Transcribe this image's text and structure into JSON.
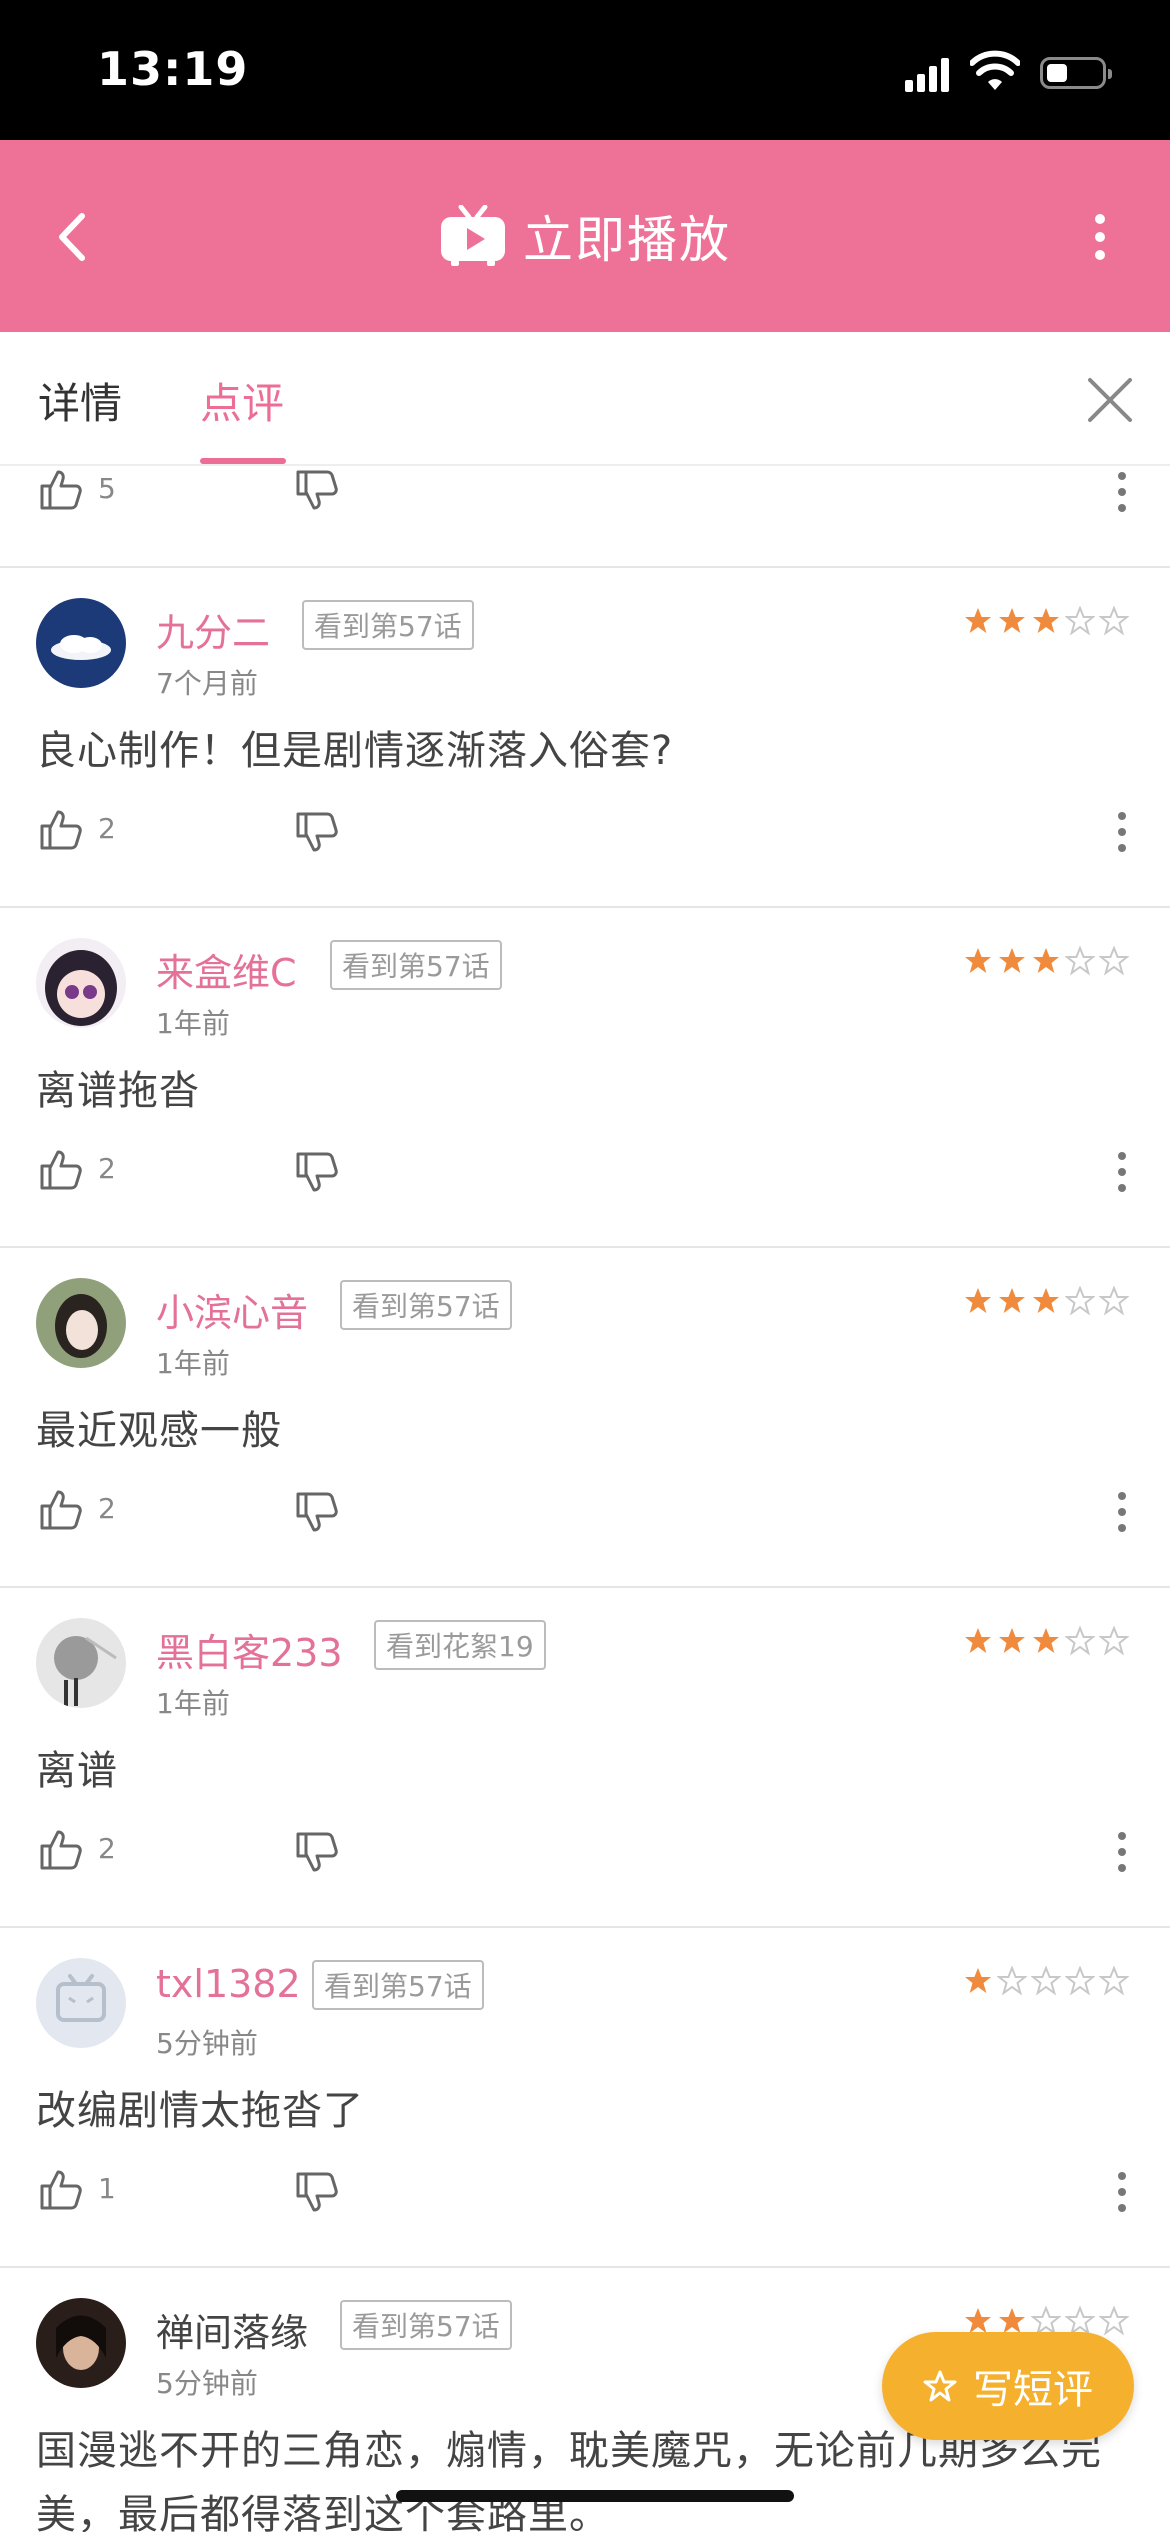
{
  "status_bar": {
    "time": "13:19"
  },
  "app_bar": {
    "title": "立即播放"
  },
  "tabs": [
    {
      "label": "详情",
      "active": false
    },
    {
      "label": "点评",
      "active": true
    }
  ],
  "partial_review": {
    "likes": "5"
  },
  "reviews": [
    {
      "username": "九分二",
      "badge": "看到第57话",
      "time": "7个月前",
      "rating": 3,
      "text": "良心制作！但是剧情逐渐落入俗套?",
      "likes": "2"
    },
    {
      "username": "来盒维C",
      "badge": "看到第57话",
      "time": "1年前",
      "rating": 3,
      "text": "离谱拖沓",
      "likes": "2"
    },
    {
      "username": "小滨心音",
      "badge": "看到第57话",
      "time": "1年前",
      "rating": 3,
      "text": "最近观感一般",
      "likes": "2"
    },
    {
      "username": "黑白客233",
      "badge": "看到花絮19",
      "time": "1年前",
      "rating": 3,
      "text": "离谱",
      "likes": "2"
    },
    {
      "username": "txl1382",
      "badge": "看到第57话",
      "time": "5分钟前",
      "rating": 1,
      "text": "改编剧情太拖沓了",
      "likes": "1"
    },
    {
      "username": "禅间落缘",
      "badge": "看到第57话",
      "time": "5分钟前",
      "rating": 2,
      "text": "国漫逃不开的三角恋，煽情，耽美魔咒，无论前几期多么完",
      "text2": "美，最后都得落到这个套路里。"
    }
  ],
  "fab": {
    "label": "写短评"
  },
  "colors": {
    "accent": "#ee7198",
    "star": "#f08a3c",
    "fab": "#f5b02e"
  }
}
